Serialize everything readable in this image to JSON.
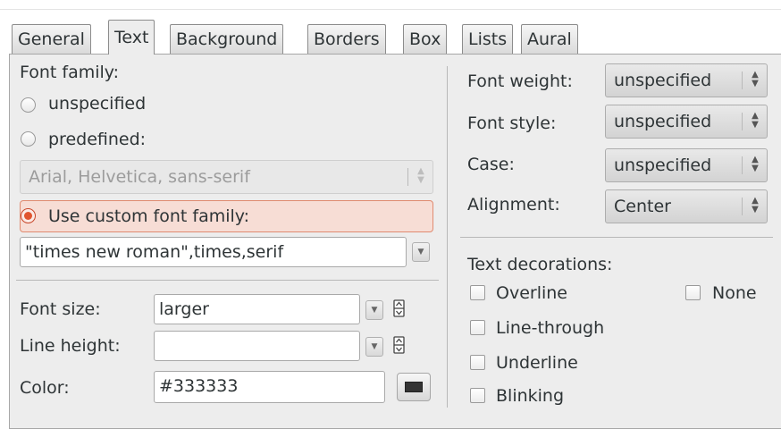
{
  "tabs": [
    {
      "label": "General",
      "active": false
    },
    {
      "label": "Text",
      "active": true
    },
    {
      "label": "Background",
      "active": false
    },
    {
      "label": "Borders",
      "active": false
    },
    {
      "label": "Box",
      "active": false
    },
    {
      "label": "Lists",
      "active": false
    },
    {
      "label": "Aural",
      "active": false
    }
  ],
  "font_family": {
    "heading": "Font family:",
    "options": [
      {
        "label": "unspecified",
        "selected": false
      },
      {
        "label": "predefined:",
        "selected": false
      },
      {
        "label": "Use custom font family:",
        "selected": true
      }
    ],
    "predefined_value": "Arial, Helvetica, sans-serif",
    "custom_value": "\"times new roman\",times,serif"
  },
  "size_section": {
    "font_size_label": "Font size:",
    "font_size_value": "larger",
    "line_height_label": "Line height:",
    "line_height_value": "",
    "color_label": "Color:",
    "color_value": "#333333"
  },
  "right": {
    "font_weight_label": "Font weight:",
    "font_weight_value": "unspecified",
    "font_style_label": "Font style:",
    "font_style_value": "unspecified",
    "case_label": "Case:",
    "case_value": "unspecified",
    "alignment_label": "Alignment:",
    "alignment_value": "Center"
  },
  "decorations": {
    "heading": "Text decorations:",
    "overline": "Overline",
    "none": "None",
    "line_through": "Line-through",
    "underline": "Underline",
    "blinking": "Blinking"
  },
  "colors": {
    "swatch": "#333333",
    "accent": "#e0552f",
    "panel_bg": "#ededed"
  },
  "icons": {
    "combo_arrow": "updown-arrows-icon",
    "dropdown": "dropdown-arrow-icon",
    "spin": "spinner-icon"
  }
}
